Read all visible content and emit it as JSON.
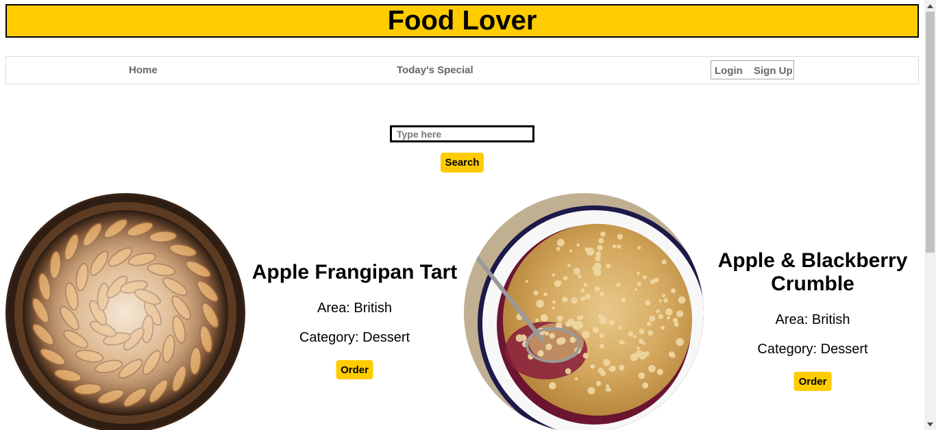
{
  "site": {
    "title": "Food Lover"
  },
  "nav": {
    "home": "Home",
    "special": "Today's Special",
    "login": "Login",
    "signup": "Sign Up"
  },
  "search": {
    "placeholder": "Type here",
    "button": "Search"
  },
  "meals": [
    {
      "name": "Apple Frangipan Tart",
      "area": "Area: British",
      "category": "Category: Dessert",
      "order": "Order"
    },
    {
      "name": "Apple & Blackberry Crumble",
      "area": "Area: British",
      "category": "Category: Dessert",
      "order": "Order"
    }
  ],
  "colors": {
    "accent": "#ffcc00",
    "border": "#000000",
    "nav_text": "#666666"
  }
}
